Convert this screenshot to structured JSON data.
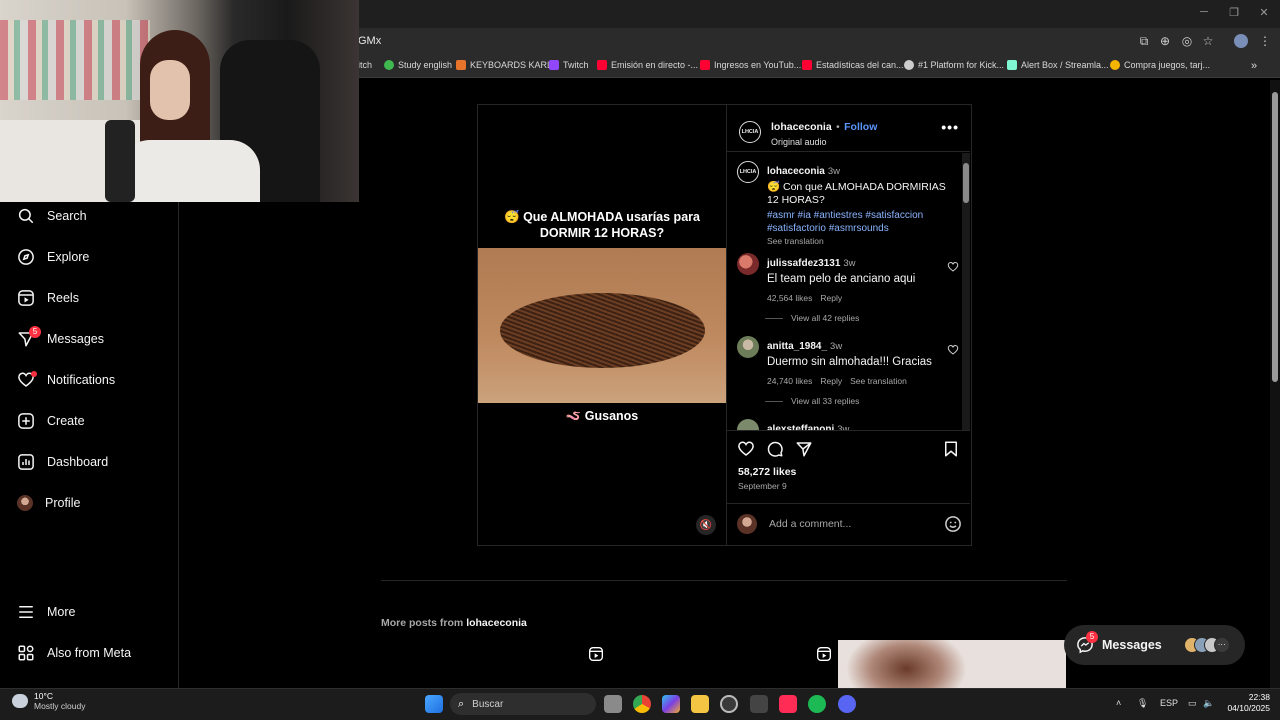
{
  "browser": {
    "url": "GMx",
    "bookmarks": [
      {
        "label": "itch",
        "color": "#9146ff"
      },
      {
        "label": "Study english",
        "color": "#3fb950"
      },
      {
        "label": "KEYBOARDS KARLI",
        "color": "#e8742b"
      },
      {
        "label": "Twitch",
        "color": "#9146ff"
      },
      {
        "label": "Emisión en directo -...",
        "color": "#ff0033"
      },
      {
        "label": "Ingresos en YouTub...",
        "color": "#ff0033"
      },
      {
        "label": "Estadísticas del can...",
        "color": "#ff0033"
      },
      {
        "label": "#1 Platform for Kick...",
        "color": "#cccccc"
      },
      {
        "label": "Alert Box / Streamla...",
        "color": "#80f5d2"
      },
      {
        "label": "Compra juegos, tarj...",
        "color": "#f4b400"
      }
    ],
    "bookmarks_overflow": "»"
  },
  "sidebar": {
    "items": [
      {
        "label": "Search",
        "icon": "search-icon"
      },
      {
        "label": "Explore",
        "icon": "compass-icon"
      },
      {
        "label": "Reels",
        "icon": "reels-icon"
      },
      {
        "label": "Messages",
        "icon": "messenger-icon",
        "badge": "5"
      },
      {
        "label": "Notifications",
        "icon": "heart-icon"
      },
      {
        "label": "Create",
        "icon": "plus-square-icon"
      },
      {
        "label": "Dashboard",
        "icon": "dashboard-icon"
      },
      {
        "label": "Profile",
        "icon": "profile-avatar"
      }
    ],
    "more": "More",
    "meta": "Also from Meta"
  },
  "post": {
    "media_caption_top": "😴 Que ALMOHADA usarías para DORMIR 12 HORAS?",
    "media_caption_bottom": "🪱 Gusanos",
    "username": "lohaceconia",
    "follow": "Follow",
    "bullet": "•",
    "audio": "Original audio",
    "logo_text": "LHCIA",
    "caption": {
      "user": "lohaceconia",
      "time": "3w",
      "text": "😴 Con que ALMOHADA DORMIRIAS 12 HORAS?",
      "tags": "#asmr #ia #antiestres #satisfaccion #satisfactorio #asmrsounds",
      "see_translation": "See translation"
    },
    "comments": [
      {
        "user": "julissafdez3131",
        "time": "3w",
        "text": "El team pelo de anciano aqui",
        "likes": "42,564 likes",
        "reply": "Reply",
        "view_replies": "View all 42 replies"
      },
      {
        "user": "anitta_1984_",
        "time": "3w",
        "text": "Duermo sin almohada!!! Gracias",
        "likes": "24,740 likes",
        "reply": "Reply",
        "see_translation": "See translation",
        "view_replies": "View all 33 replies"
      },
      {
        "user": "alexsteffanoni",
        "time": "3w"
      }
    ],
    "likes": "58,272 likes",
    "date": "September 9",
    "add_comment_placeholder": "Add a comment..."
  },
  "more_posts": {
    "prefix": "More posts from",
    "user": "lohaceconia"
  },
  "messages_pill": {
    "label": "Messages",
    "badge": "5"
  },
  "taskbar": {
    "weather_temp": "10°C",
    "weather_desc": "Mostly cloudy",
    "search": "Buscar",
    "lang": "ESP",
    "time": "22:38",
    "date": "04/10/2025"
  }
}
